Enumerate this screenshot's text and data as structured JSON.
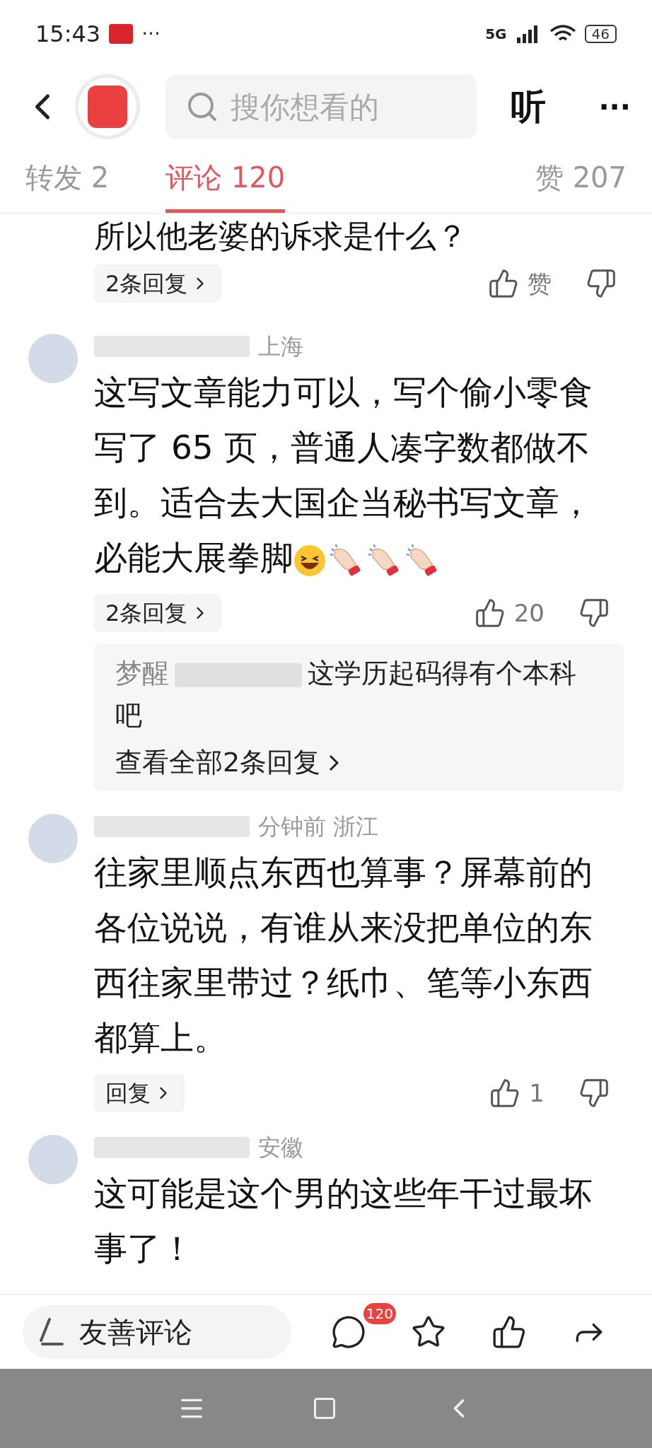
{
  "status_bar": {
    "time": "15:43",
    "more": "···",
    "network": "5G",
    "battery": "46"
  },
  "header": {
    "search": {
      "placeholder": "搜你想看的"
    },
    "listen": "听",
    "more": "···"
  },
  "tabs": [
    {
      "label": "转发 2",
      "selected": false
    },
    {
      "label": "评论 120",
      "selected": true
    },
    {
      "label": "赞 207",
      "selected": false
    }
  ],
  "comments": [
    {
      "kind": "partial",
      "text": "所以他老婆的诉求是什么？",
      "reply_button": "2条回复",
      "like": "赞"
    },
    {
      "kind": "full",
      "meta": "上海",
      "text": "这写文章能力可以，写个偷小零食写了 65 页，普通人凑字数都做不到。适合去大国企当秘书写文章，必能大展拳脚",
      "emoji": [
        {
          "kind": "grin"
        },
        {
          "kind": "clap"
        },
        {
          "kind": "clap"
        },
        {
          "kind": "clap"
        }
      ],
      "reply_button": "2条回复",
      "like": "20",
      "preview": {
        "author": "梦醒",
        "text": "这学历起码得有个本科吧",
        "more": "查看全部2条回复"
      }
    },
    {
      "kind": "full",
      "meta": "分钟前  浙江",
      "text": "往家里顺点东西也算事？屏幕前的各位说说，有谁从来没把单位的东西往家里带过？纸巾、笔等小东西都算上。",
      "reply_button": "回复",
      "like": "1"
    },
    {
      "kind": "full",
      "meta": "安徽",
      "text": "这可能是这个男的这些年干过最坏事了！"
    }
  ],
  "bottom_bar": {
    "input": {
      "placeholder": "友善评论"
    },
    "comment_count": "120"
  }
}
